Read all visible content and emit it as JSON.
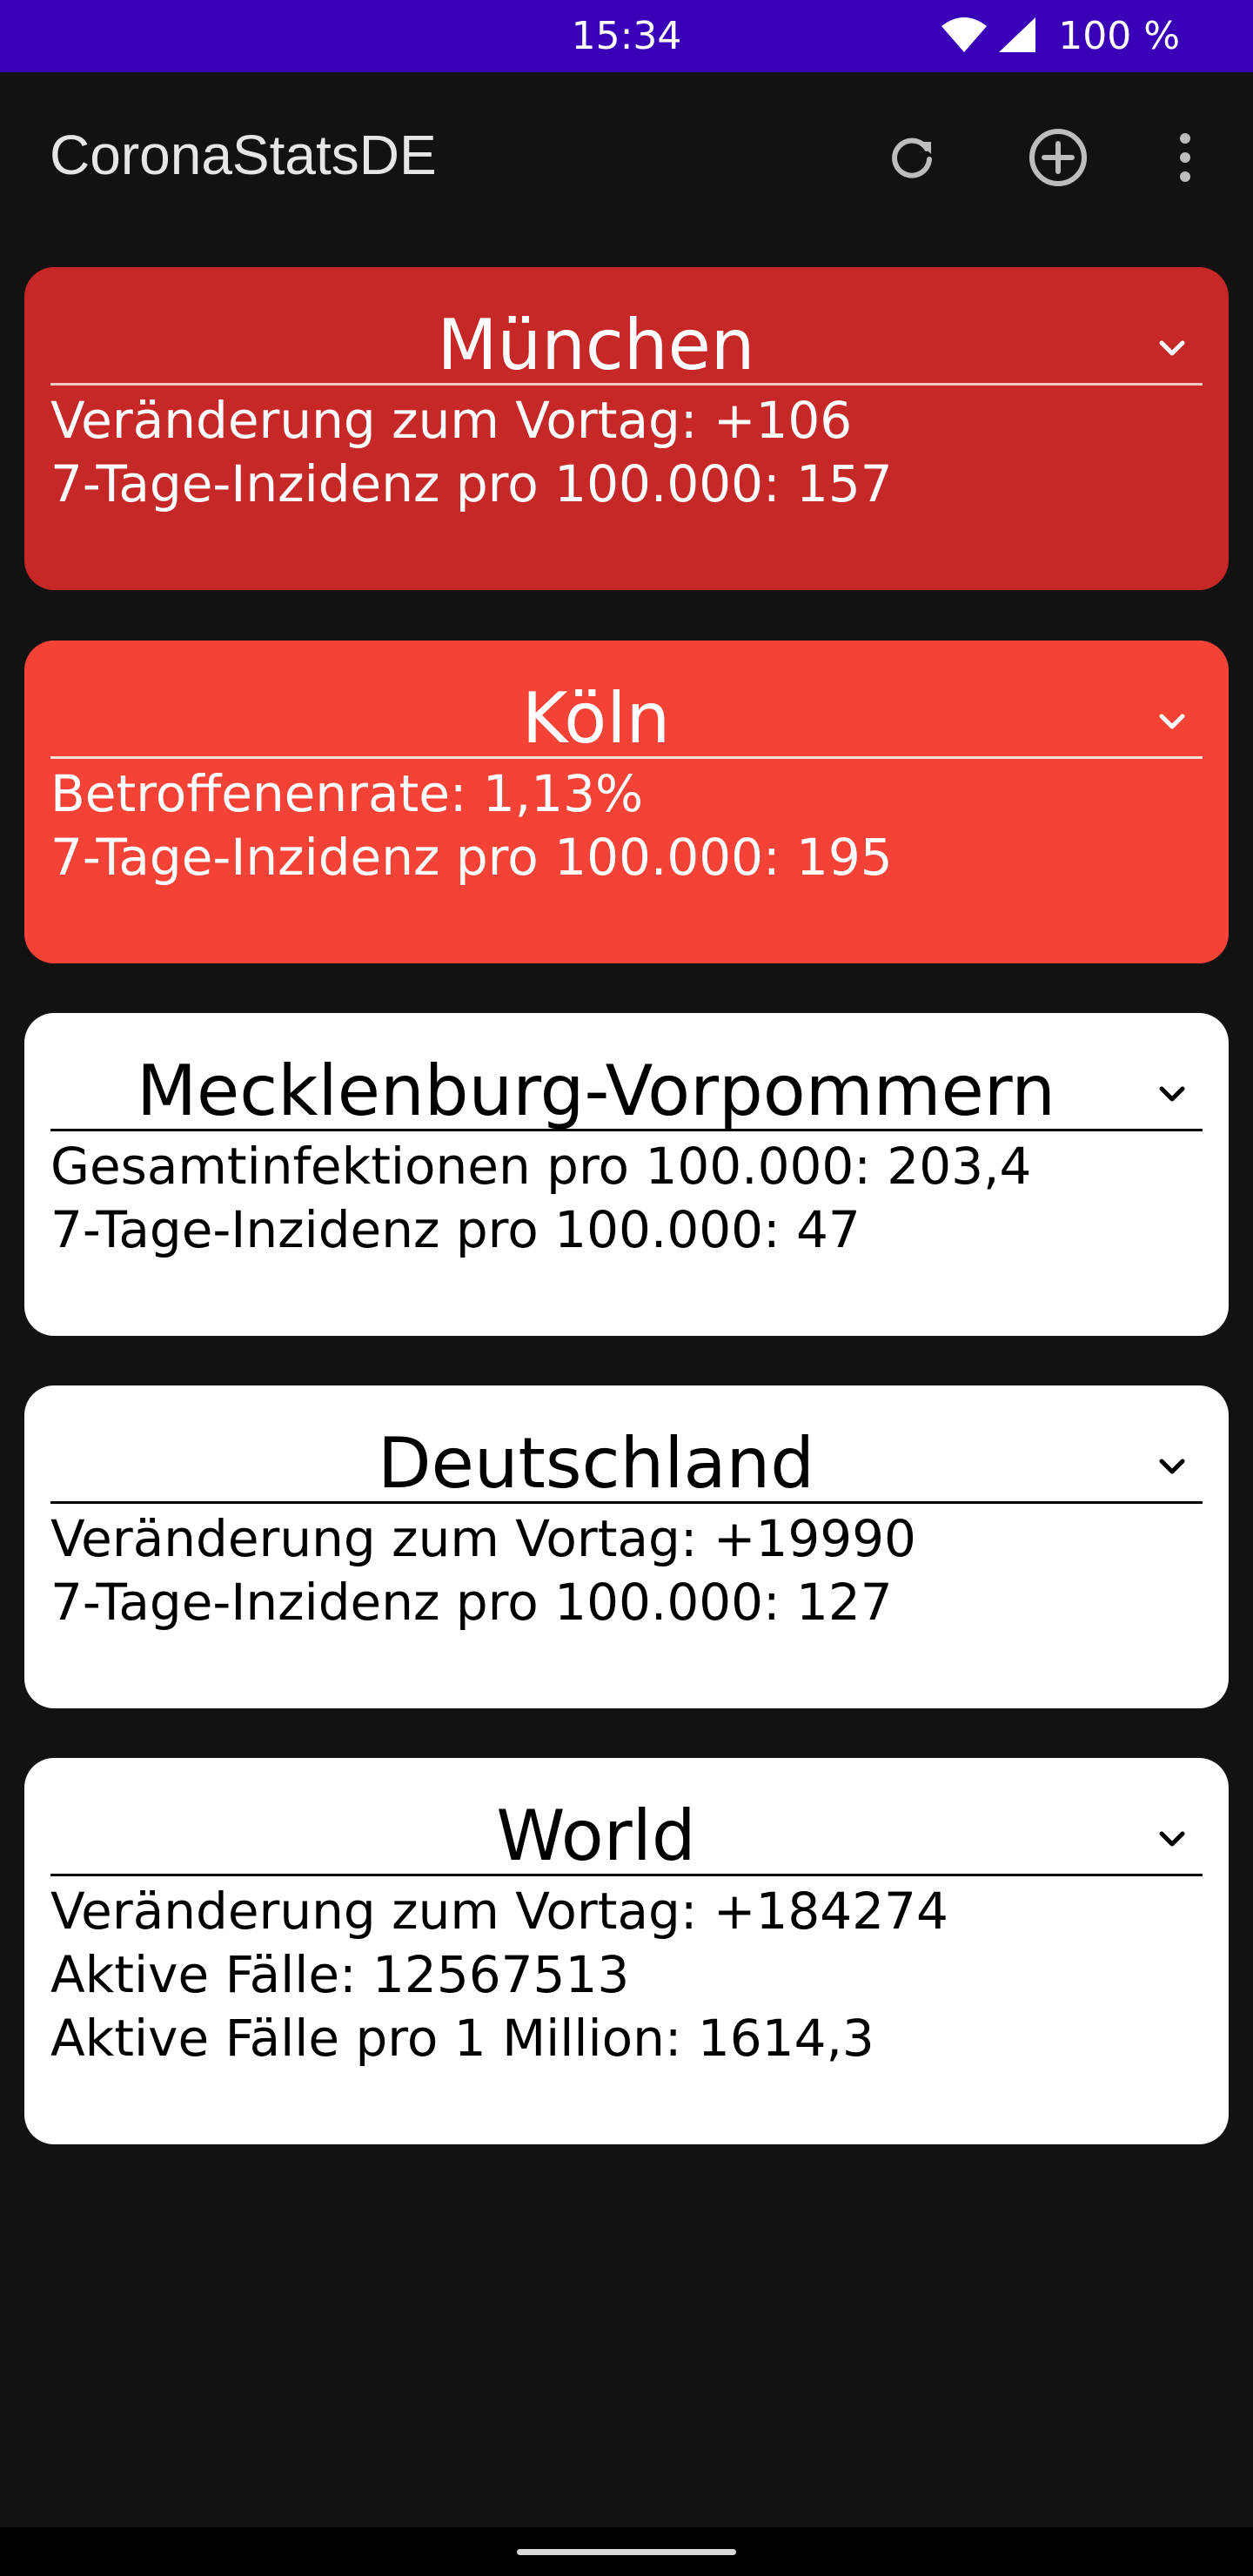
{
  "status_bar": {
    "time": "15:34",
    "battery": "100 %",
    "icons": [
      "wifi-icon",
      "signal-icon"
    ]
  },
  "app_bar": {
    "title": "CoronaStatsDE",
    "actions": [
      "refresh-icon",
      "add-circle-icon",
      "more-vert-icon"
    ]
  },
  "colors": {
    "status_bar": "#3a00b8",
    "background": "#121212",
    "card_dark_red": "#c62828",
    "card_red": "#f44336",
    "card_white": "#ffffff"
  },
  "cards": [
    {
      "title": "München",
      "theme": "dark-red",
      "lines": [
        "Veränderung zum Vortag: +106",
        "7-Tage-Inzidenz pro 100.000: 157"
      ]
    },
    {
      "title": "Köln",
      "theme": "red",
      "lines": [
        "Betroffenenrate: 1,13%",
        "7-Tage-Inzidenz pro 100.000: 195"
      ]
    },
    {
      "title": "Mecklenburg-Vorpommern",
      "theme": "white",
      "lines": [
        "Gesamtinfektionen pro 100.000: 203,4",
        "7-Tage-Inzidenz pro 100.000: 47"
      ]
    },
    {
      "title": "Deutschland",
      "theme": "white",
      "lines": [
        "Veränderung zum Vortag: +19990",
        "7-Tage-Inzidenz pro 100.000: 127"
      ]
    },
    {
      "title": "World",
      "theme": "white",
      "lines": [
        "Veränderung zum Vortag: +184274",
        "Aktive Fälle: 12567513",
        "Aktive Fälle pro 1 Million: 1614,3"
      ]
    }
  ]
}
